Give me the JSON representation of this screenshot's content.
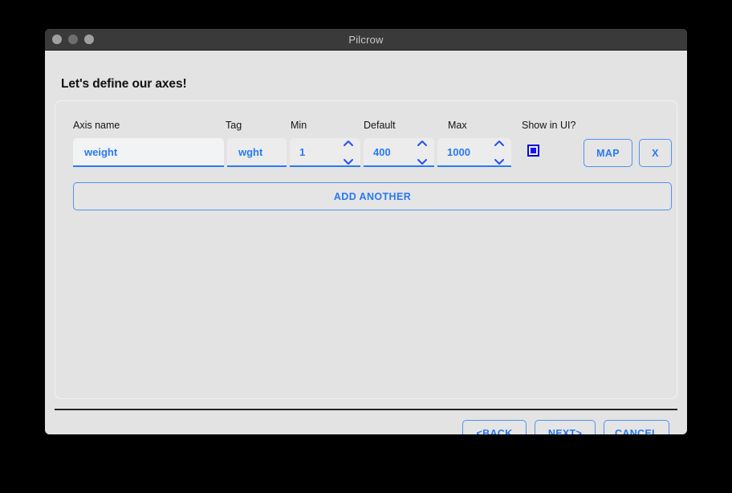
{
  "window": {
    "title": "Pilcrow",
    "traffic_lights": [
      "close-button",
      "minimize-button",
      "zoom-button"
    ]
  },
  "page": {
    "heading": "Let's define our axes!"
  },
  "table": {
    "columns": [
      {
        "key": "axis_name",
        "label": "Axis name"
      },
      {
        "key": "tag",
        "label": "Tag"
      },
      {
        "key": "min",
        "label": "Min"
      },
      {
        "key": "default",
        "label": "Default"
      },
      {
        "key": "max",
        "label": "Max"
      },
      {
        "key": "show_in_ui",
        "label": "Show in UI?"
      }
    ],
    "rows": [
      {
        "axis_name": "weight",
        "axis_name_placeholder": "Axis name",
        "tag": "wght",
        "tag_placeholder": "Tag",
        "min": "1",
        "default": "400",
        "max": "1000",
        "show_in_ui": true,
        "map_label": "MAP",
        "remove_label": "X"
      }
    ]
  },
  "actions": {
    "add_another": "ADD ANOTHER"
  },
  "footer": {
    "back_prefix": "< ",
    "back_mnemonic": "B",
    "back_rest": "ACK",
    "next_mnemonic": "N",
    "next_rest": "EXT",
    "next_suffix": " >",
    "cancel": "CANCEL"
  },
  "colors": {
    "accent_blue": "#2979f2",
    "checkbox_blue": "#1414f0",
    "window_bg": "#e3e3e3",
    "titlebar_bg": "#3a3a3a",
    "separator": "#242424"
  }
}
